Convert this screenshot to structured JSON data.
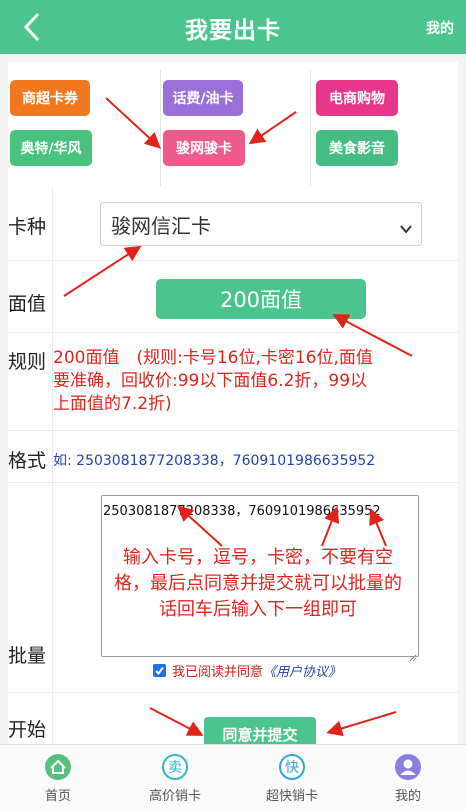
{
  "header": {
    "title": "我要出卡",
    "mine": "我的"
  },
  "categories": [
    {
      "label": "商超卡券",
      "color": "#f07820"
    },
    {
      "label": "话费/油卡",
      "color": "#9a6fd8"
    },
    {
      "label": "电商购物",
      "color": "#e8368c"
    },
    {
      "label": "奥特/华风",
      "color": "#49c27e"
    },
    {
      "label": "骏网骏卡",
      "color": "#ef5a8c"
    },
    {
      "label": "美食影音",
      "color": "#45bd85"
    }
  ],
  "form": {
    "card_type": {
      "label": "卡种",
      "selected": "骏网信汇卡"
    },
    "face_value": {
      "label": "面值",
      "button": "200面值"
    },
    "rules": {
      "label": "规则",
      "text": "200面值　(规则:卡号16位,卡密16位,面值要准确，回收价:99以下面值6.2折，99以上面值的7.2折)"
    },
    "format": {
      "label": "格式",
      "text": "如: 2503081877208338，7609101986635952"
    },
    "batch": {
      "label": "批量",
      "value": "2503081877208338，7609101986635952",
      "hint": "输入卡号，逗号，卡密，不要有空格，最后点同意并提交就可以批量的话回车后输入下一组即可"
    },
    "agree": {
      "text": "我已阅读并同意",
      "link": "《用户协议》",
      "checked": true
    },
    "start": {
      "label": "开始",
      "button": "同意并提交"
    }
  },
  "tabs": [
    {
      "label": "首页",
      "icon": "home-icon",
      "color": "#57c07e"
    },
    {
      "label": "高价销卡",
      "icon": "sell-icon",
      "glyph": "卖",
      "color": "#2fb7c9"
    },
    {
      "label": "超快销卡",
      "icon": "fast-icon",
      "glyph": "快",
      "color": "#2fa6e0"
    },
    {
      "label": "我的",
      "icon": "user-icon",
      "color": "#8a7fe0"
    }
  ],
  "colors": {
    "accent": "#4cc48e",
    "warning": "#e0241b",
    "link": "#2344a8"
  }
}
